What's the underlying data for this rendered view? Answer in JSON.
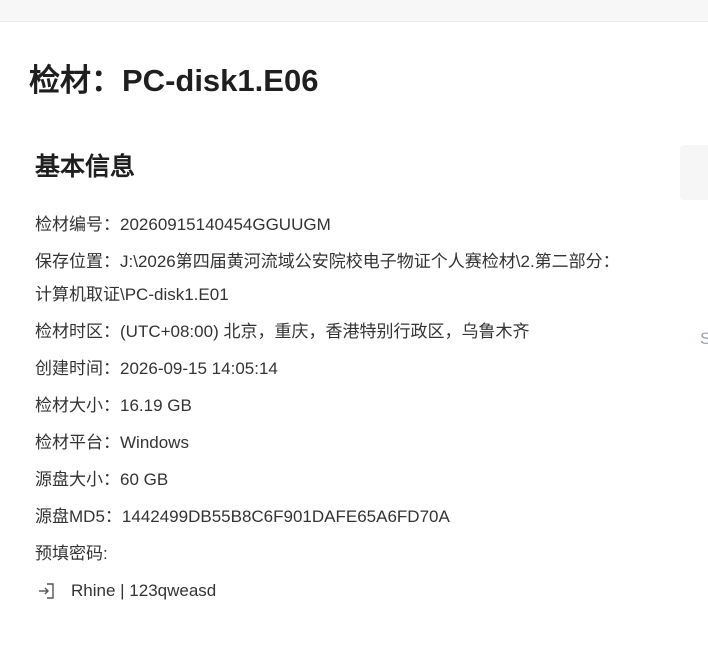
{
  "page": {
    "title": "检材：PC-disk1.E06"
  },
  "basic_info": {
    "section_title": "基本信息",
    "rows": [
      {
        "label": "检材编号：",
        "value": "20260915140454GGUUGM"
      },
      {
        "label": "保存位置：",
        "value": "J:\\2026第四届黄河流域公安院校电子物证个人赛检材\\2.第二部分：计算机取证\\PC-disk1.E01"
      },
      {
        "label": "检材时区：",
        "value": "(UTC+08:00) 北京，重庆，香港特别行政区，乌鲁木齐"
      },
      {
        "label": "创建时间：",
        "value": "2026-09-15 14:05:14"
      },
      {
        "label": "检材大小：",
        "value": "16.19 GB"
      },
      {
        "label": "检材平台：",
        "value": "Windows"
      },
      {
        "label": "源盘大小：",
        "value": "60 GB"
      },
      {
        "label": "源盘MD5：",
        "value": "1442499DB55B8C6F901DAFE65A6FD70A"
      }
    ],
    "password_label": "预填密码:",
    "password_entry": "Rhine | 123qweasd",
    "password_icon": "login-arrow-icon"
  },
  "side_panel": {
    "glyph": "S"
  }
}
